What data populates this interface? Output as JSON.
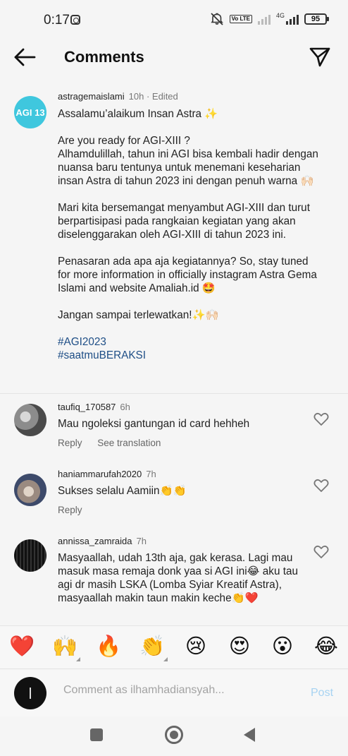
{
  "status_bar": {
    "time": "0:17",
    "network": "4G",
    "volte": "Vo LTE",
    "battery": "95",
    "icons": [
      "instagram-notification-icon",
      "mute-icon",
      "signal-icon",
      "battery-icon"
    ]
  },
  "header": {
    "title": "Comments",
    "back_icon": "arrow-left-icon",
    "share_icon": "paper-plane-icon"
  },
  "caption": {
    "username": "astragemaislami",
    "time": "10h · Edited",
    "avatar_text": "AGI 13",
    "avatar_color": "#3fc7de",
    "paragraphs": [
      "Assalamu’alaikum Insan Astra ✨",
      "Are you ready for AGI-XIII ?",
      "Alhamdulillah, tahun ini AGI bisa kembali hadir dengan nuansa baru tentunya untuk menemani keseharian insan Astra di tahun 2023 ini dengan penuh warna 🙌🏻",
      "Mari kita bersemangat menyambut AGI-XIII dan turut berpartisipasi pada rangkaian kegiatan yang akan diselenggarakan oleh AGI-XIII di tahun 2023 ini.",
      "Penasaran ada apa aja kegiatannya? So, stay tuned for more information in officially instagram Astra Gema Islami and website Amaliah.id 🤩",
      "Jangan sampai terlewatkan!✨🙌🏻"
    ],
    "hashtags": [
      "#AGI2023",
      "#saatmuBERAKSI"
    ],
    "hashtag_color": "#1e4e86"
  },
  "comments": [
    {
      "username": "taufiq_170587",
      "time": "6h",
      "text": "Mau ngoleksi gantungan id card hehheh",
      "reply": "Reply",
      "translate": "See translation"
    },
    {
      "username": "haniammarufah2020",
      "time": "7h",
      "text": "Sukses selalu Aamiin👏👏",
      "reply": "Reply"
    },
    {
      "username": "annissa_zamraida",
      "time": "7h",
      "text": "Masyaallah, udah 13th aja, gak kerasa. Lagi mau masuk masa remaja donk yaa si AGI ini😂 aku tau agi dr masih LSKA (Lomba Syiar Kreatif Astra), masyaallah makin taun makin keche👏❤️"
    }
  ],
  "emoji_bar": [
    "❤️",
    "🙌",
    "🔥",
    "👏",
    "😢",
    "😍",
    "😮",
    "😂"
  ],
  "compose": {
    "placeholder": "Comment as ilhamhadiansyah...",
    "post_label": "Post",
    "post_color": "#a7d3f2"
  },
  "nav_icons": [
    "recents-square-icon",
    "home-circle-icon",
    "back-triangle-icon"
  ]
}
